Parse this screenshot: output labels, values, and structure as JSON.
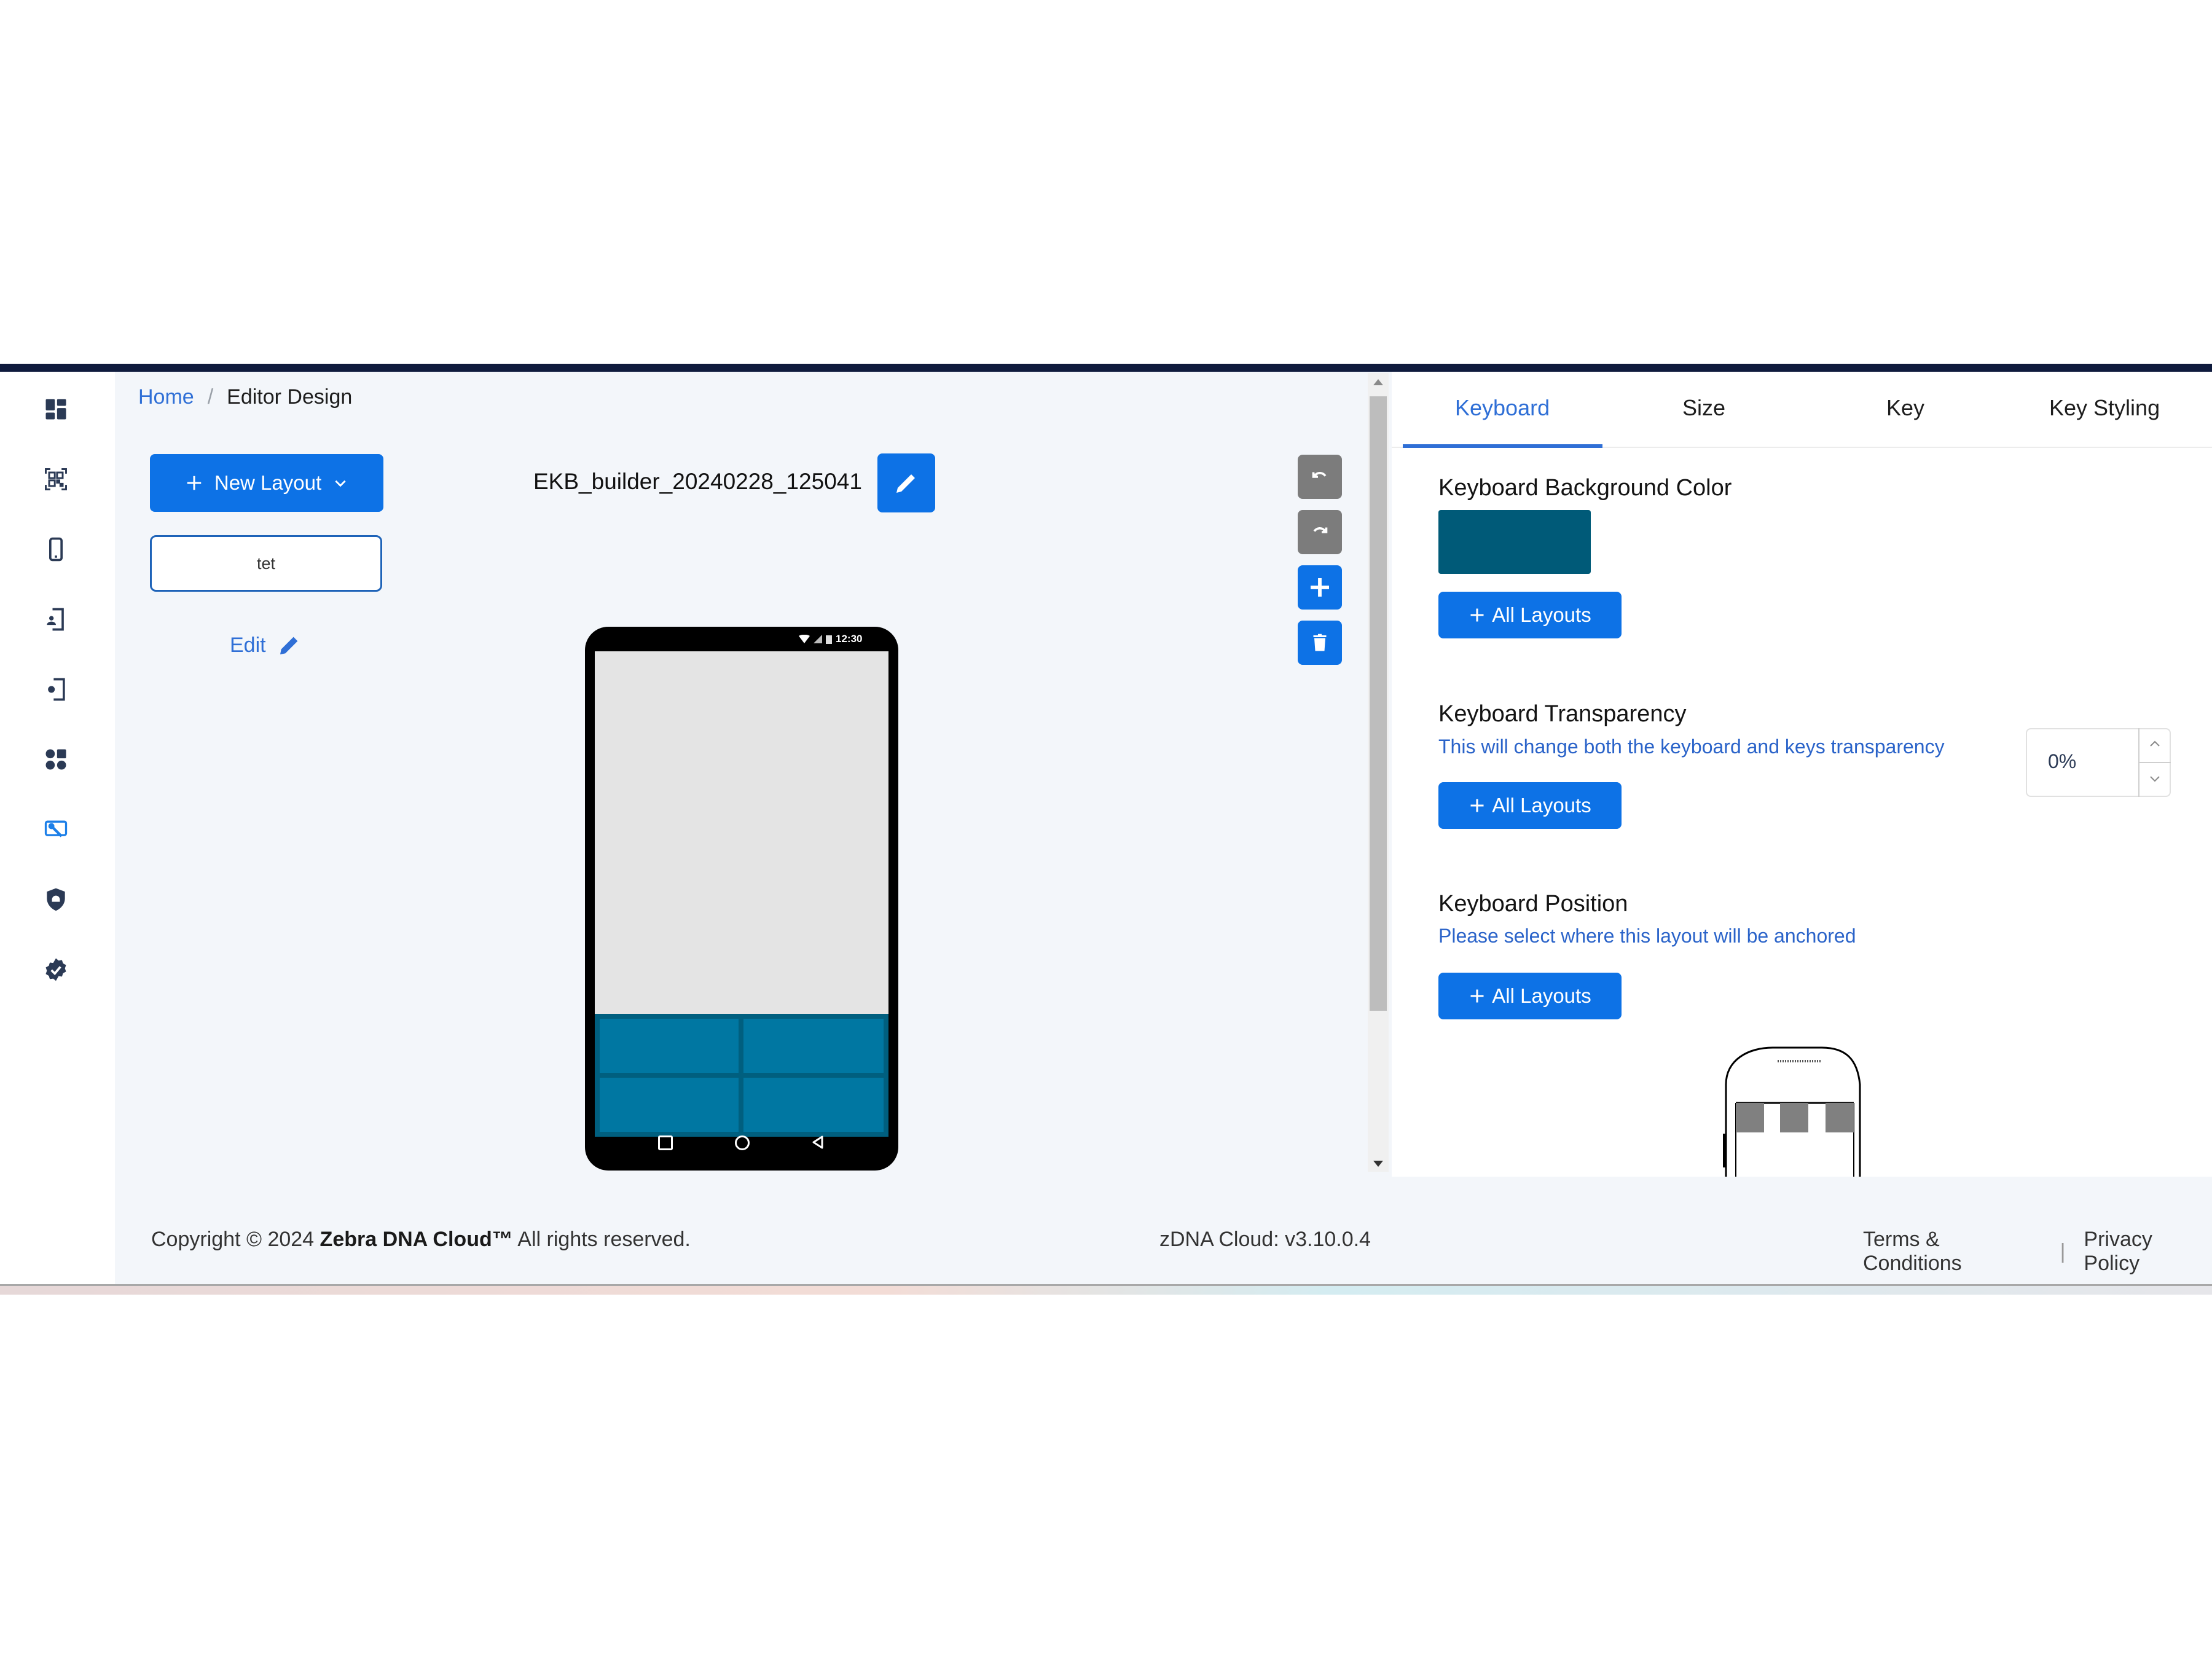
{
  "sidebar": {
    "items": [
      {
        "name": "dashboard-icon",
        "active": false
      },
      {
        "name": "barcode-scan-icon",
        "active": false
      },
      {
        "name": "mobile-device-icon",
        "active": false
      },
      {
        "name": "device-user-icon",
        "active": false
      },
      {
        "name": "device-settings-icon",
        "active": false
      },
      {
        "name": "apps-icon",
        "active": false
      },
      {
        "name": "keyboard-design-icon",
        "active": true
      },
      {
        "name": "android-shield-icon",
        "active": false
      },
      {
        "name": "verified-badge-icon",
        "active": false
      }
    ],
    "icon_color": "#2b3a55",
    "active_color": "#1c7fe8"
  },
  "breadcrumb": {
    "home": "Home",
    "separator": "/",
    "current": "Editor Design"
  },
  "layouts": {
    "new_layout_label": "New Layout",
    "items": [
      "tet"
    ],
    "edit_label": "Edit"
  },
  "editor": {
    "layout_name": "EKB_builder_20240228_125041",
    "phone": {
      "status_time": "12:30",
      "keyboard_rows": 2,
      "keyboard_cols": 2,
      "nav_buttons": [
        "recent-apps",
        "home",
        "back"
      ]
    },
    "tools": [
      "undo",
      "redo",
      "add",
      "delete"
    ]
  },
  "right_panel": {
    "tabs": [
      {
        "label": "Keyboard",
        "active": true
      },
      {
        "label": "Size",
        "active": false
      },
      {
        "label": "Key",
        "active": false
      },
      {
        "label": "Key Styling",
        "active": false
      }
    ],
    "sections": {
      "background": {
        "title": "Keyboard Background Color",
        "color": "#005a78",
        "button": "All Layouts"
      },
      "transparency": {
        "title": "Keyboard Transparency",
        "description": "This will change both the keyboard and keys transparency",
        "value": "0%",
        "button": "All Layouts"
      },
      "position": {
        "title": "Keyboard Position",
        "description": "Please select where this layout will be anchored",
        "button": "All Layouts"
      }
    }
  },
  "footer": {
    "copyright_prefix": "Copyright © 2024 ",
    "brand": "Zebra DNA Cloud™",
    "copyright_suffix": " All rights reserved.",
    "version": "zDNA Cloud: v3.10.0.4",
    "terms": "Terms & Conditions",
    "divider": "|",
    "privacy": "Privacy Policy"
  },
  "colors": {
    "primary": "#0d72e6",
    "link": "#2f6fd6",
    "topbar": "#0f1b3d",
    "key": "#0077a2",
    "keyboard_bg": "#005f7f"
  }
}
